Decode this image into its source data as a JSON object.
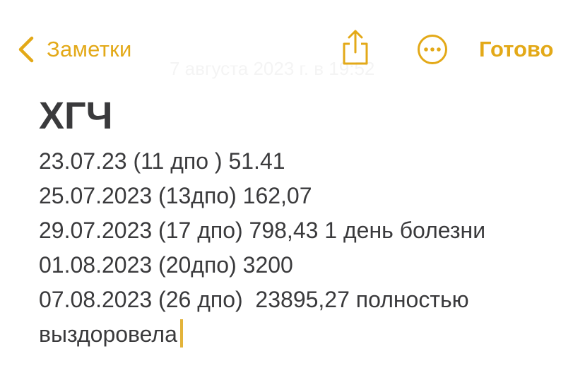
{
  "nav": {
    "back_label": "Заметки",
    "timestamp": "7 августа 2023 г. в 19:52",
    "done_label": "Готово",
    "icons": {
      "back": "chevron-left-icon",
      "share": "share-icon",
      "more": "ellipsis-circle-icon"
    },
    "accent_color": "#e3a918"
  },
  "note": {
    "title": "ХГЧ",
    "lines": [
      "23.07.23 (11 дпо ) 51.41",
      "25.07.2023 (13дпо) 162,07",
      "29.07.2023 (17 дпо) 798,43 1 день болезни",
      "01.08.2023 (20дпо) 3200",
      "07.08.2023 (26 дпо)  23895,27 полностью",
      "выздоровела"
    ]
  }
}
